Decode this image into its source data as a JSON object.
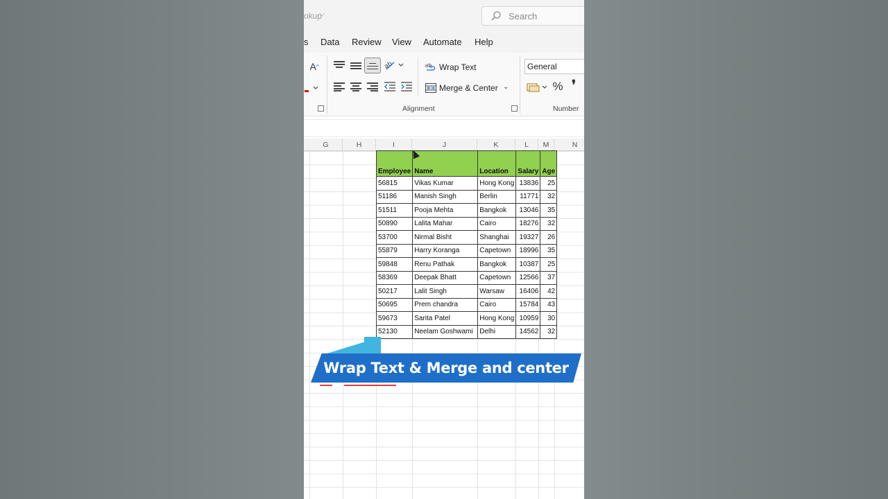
{
  "title": {
    "fragment": "okup"
  },
  "search": {
    "placeholder": "Search"
  },
  "tabs": [
    "s",
    "Data",
    "Review",
    "View",
    "Automate",
    "Help"
  ],
  "ribbon": {
    "font_grow_label": "A",
    "wrap_text_label": "Wrap Text",
    "merge_center_label": "Merge & Center",
    "alignment_group_label": "Alignment",
    "number_format_value": "General",
    "percent_label": "%",
    "comma_label": "❜",
    "number_group_label": "Number"
  },
  "columns": [
    "G",
    "H",
    "I",
    "J",
    "K",
    "L",
    "M",
    "N"
  ],
  "table": {
    "headers": [
      "Employee",
      "Name",
      "Location",
      "Salary",
      "Age"
    ],
    "rows": [
      [
        "56815",
        "Vikas Kumar",
        "Hong Kong",
        "13836",
        "25"
      ],
      [
        "51186",
        "Manish Singh",
        "Berlin",
        "11771",
        "32"
      ],
      [
        "51511",
        "Pooja Mehta",
        "Bangkok",
        "13046",
        "35"
      ],
      [
        "50890",
        "Lalita Mahar",
        "Cairo",
        "18276",
        "32"
      ],
      [
        "53700",
        "Nirmal Bisht",
        "Shanghai",
        "19327",
        "26"
      ],
      [
        "55879",
        "Harry Koranga",
        "Capetown",
        "18996",
        "35"
      ],
      [
        "59848",
        "Renu Pathak",
        "Bangkok",
        "10387",
        "25"
      ],
      [
        "58369",
        "Deepak Bhatt",
        "Capetown",
        "12566",
        "37"
      ],
      [
        "50217",
        "Lalit Singh",
        "Warsaw",
        "16406",
        "42"
      ],
      [
        "50695",
        "Prem chandra",
        "Cairo",
        "15784",
        "43"
      ],
      [
        "59673",
        "Sarita Patel",
        "Hong Kong",
        "10959",
        "30"
      ],
      [
        "52130",
        "Neelam Goshwami",
        "Delhi",
        "14562",
        "32"
      ]
    ]
  },
  "banner": {
    "text": "Wrap Text & Merge and center"
  },
  "colors": {
    "header_fill": "#92d050",
    "banner_blue": "#1f6fc9",
    "banner_accent": "#3fb5e0"
  }
}
